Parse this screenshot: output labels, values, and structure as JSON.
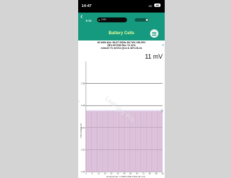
{
  "status_bar": {
    "time": "14:47",
    "network": "4G",
    "battery": "46"
  },
  "call_banner": {
    "time": "9:33",
    "text": "1:01"
  },
  "header": {
    "title": "Battery Cells"
  },
  "summary": {
    "line1": "40 kWh  Ahr: 96.67  SOHc 83.74%  236.00V",
    "line2": "ZE1-007156   Rev 72.12%",
    "line3": "mins47.71 mV/11 QCs & 1871.0L2s"
  },
  "chart_data": {
    "type": "bar",
    "title": "11 mV",
    "xlabel": "min/ave/max = 3.509 3.509 3.520 (11 mV)",
    "ylabel": "Cell Voltage (V)",
    "ylim": [
      3.3,
      3.4
    ],
    "y_ticks": [
      "3.38",
      "3.36",
      "3.34",
      "3.32",
      "3.30"
    ],
    "x_ticks": [
      "0",
      "8",
      "16",
      "24",
      "32",
      "40",
      "48",
      "56",
      "64",
      "72",
      "80",
      "88",
      "96"
    ],
    "cell_count": 96,
    "values": [
      3.355,
      3.356,
      3.355,
      3.356,
      3.355,
      3.356,
      3.355,
      3.356,
      3.355,
      3.356,
      3.355,
      3.356,
      3.355,
      3.356,
      3.355,
      3.356,
      3.355,
      3.356,
      3.355,
      3.356,
      3.355,
      3.356,
      3.355,
      3.356,
      3.355,
      3.356,
      3.355,
      3.356,
      3.355,
      3.356,
      3.355,
      3.356,
      3.355,
      3.356,
      3.355,
      3.356,
      3.355,
      3.356,
      3.355,
      3.356,
      3.355,
      3.356,
      3.355,
      3.356,
      3.355,
      3.356,
      3.355,
      3.356,
      3.355,
      3.356,
      3.355,
      3.356,
      3.355,
      3.356,
      3.355,
      3.356,
      3.355,
      3.356,
      3.355,
      3.356,
      3.355,
      3.356,
      3.355,
      3.356,
      3.355,
      3.356,
      3.355,
      3.356,
      3.355,
      3.356,
      3.355,
      3.356,
      3.355,
      3.356,
      3.355,
      3.356,
      3.355,
      3.356,
      3.355,
      3.356,
      3.355,
      3.356,
      3.355,
      3.356,
      3.355,
      3.356,
      3.355,
      3.356,
      3.355,
      3.356,
      3.355,
      3.356,
      3.355,
      3.356,
      3.355,
      3.356
    ],
    "bar_colors": [
      "#e9a4b4",
      "#b9b4e9"
    ]
  },
  "watermark": "Leaf Spy Pro"
}
